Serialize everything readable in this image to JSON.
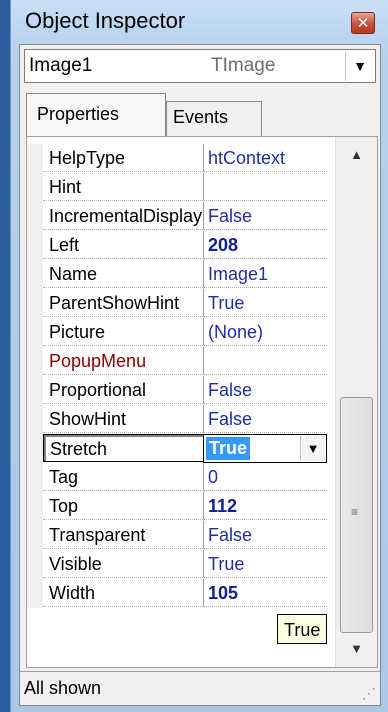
{
  "window": {
    "title": "Object Inspector",
    "close_glyph": "✕"
  },
  "object_selector": {
    "name": "Image1",
    "type": "TImage",
    "dropdown_glyph": "▼"
  },
  "tabs": [
    {
      "label": "Properties"
    },
    {
      "label": "Events"
    }
  ],
  "properties": [
    {
      "name": "HelpType",
      "value": "htContext",
      "bold": false
    },
    {
      "name": "Hint",
      "value": "",
      "bold": false
    },
    {
      "name": "IncrementalDisplay",
      "value": "False",
      "bold": false
    },
    {
      "name": "Left",
      "value": "208",
      "bold": true
    },
    {
      "name": "Name",
      "value": "Image1",
      "bold": false
    },
    {
      "name": "ParentShowHint",
      "value": "True",
      "bold": false
    },
    {
      "name": "Picture",
      "value": "(None)",
      "bold": false
    },
    {
      "name": "PopupMenu",
      "value": "",
      "bold": false,
      "event_link": true
    },
    {
      "name": "Proportional",
      "value": "False",
      "bold": false
    },
    {
      "name": "ShowHint",
      "value": "False",
      "bold": false
    },
    {
      "name": "Stretch",
      "value": "True",
      "bold": true,
      "selected": true
    },
    {
      "name": "Tag",
      "value": "0",
      "bold": false
    },
    {
      "name": "Top",
      "value": "112",
      "bold": true
    },
    {
      "name": "Transparent",
      "value": "False",
      "bold": false
    },
    {
      "name": "Visible",
      "value": "True",
      "bold": false
    },
    {
      "name": "Width",
      "value": "105",
      "bold": true
    }
  ],
  "editor": {
    "value": "True",
    "dropdown_glyph": "▼"
  },
  "tooltip": {
    "text": "True"
  },
  "scrollbar": {
    "up_glyph": "▲",
    "down_glyph": "▼",
    "grip_glyph": "≡"
  },
  "status": {
    "text": "All shown",
    "resize_glyph": "⋰"
  },
  "colors": {
    "value_blue": "#1f2fa0",
    "event_red": "#8b0000",
    "selection": "#3399ff",
    "tooltip_bg": "#ffffe1"
  }
}
